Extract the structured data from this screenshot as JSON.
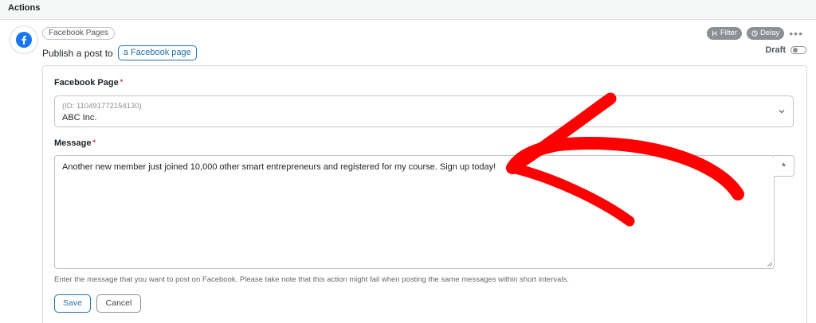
{
  "section": {
    "title": "Actions"
  },
  "app": {
    "name": "Facebook Pages",
    "icon": "facebook-icon",
    "brand_color": "#1877f2"
  },
  "action": {
    "prefix": "Publish a post to",
    "target": "a Facebook page"
  },
  "controls": {
    "filter": "Filter",
    "delay": "Delay",
    "more": "•••",
    "draft": "Draft"
  },
  "form": {
    "page_field": {
      "label": "Facebook Page",
      "required": "*",
      "id_text": "(ID: 110491772154130)",
      "value": "ABC Inc."
    },
    "message_field": {
      "label": "Message",
      "required": "*",
      "value": "Another new member just joined 10,000 other smart entrepreneurs and registered for my course. Sign up today!",
      "insert_button": "*",
      "help": "Enter the message that you want to post on Facebook. Please take note that this action might fail when posting the same messages within short intervals."
    },
    "save_label": "Save",
    "cancel_label": "Cancel"
  },
  "annotation": {
    "arrow_color": "#ff0000"
  },
  "colors": {
    "accent": "#2271b1",
    "required": "#d63638"
  }
}
